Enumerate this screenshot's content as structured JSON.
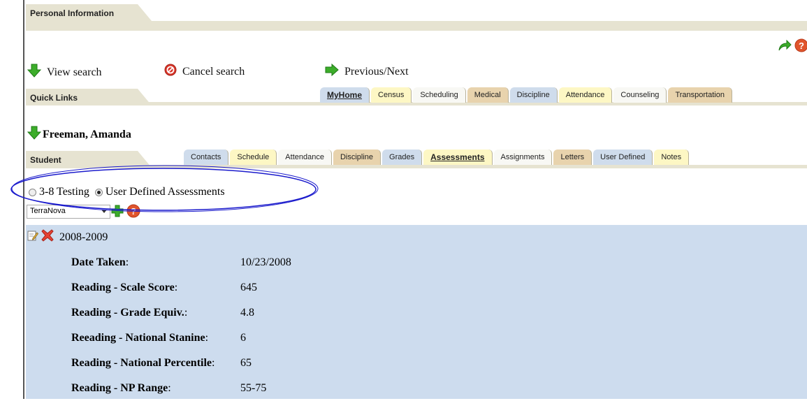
{
  "personal_info": {
    "title": "Personal Information"
  },
  "top_icons": {
    "forward": "forward-arrow-icon",
    "help": "help-icon"
  },
  "search_bar": {
    "view_search": "View search",
    "cancel_search": "Cancel search",
    "previous_next": "Previous/Next"
  },
  "quick_links": {
    "title": "Quick Links",
    "tabs": [
      {
        "label": "MyHome",
        "color": "#cfdcec",
        "active": true
      },
      {
        "label": "Census",
        "color": "#fdf7c4"
      },
      {
        "label": "Scheduling",
        "color": "#f8f8f4"
      },
      {
        "label": "Medical",
        "color": "#e8d3ad"
      },
      {
        "label": "Discipline",
        "color": "#cfdcec"
      },
      {
        "label": "Attendance",
        "color": "#fdf7c4"
      },
      {
        "label": "Counseling",
        "color": "#f8f8f4"
      },
      {
        "label": "Transportation",
        "color": "#e8d3ad"
      }
    ]
  },
  "student": {
    "name": "Freeman, Amanda",
    "title": "Student",
    "tabs": [
      {
        "label": "Contacts",
        "color": "#cfdcec"
      },
      {
        "label": "Schedule",
        "color": "#fdf7c4"
      },
      {
        "label": "Attendance",
        "color": "#f8f8f4"
      },
      {
        "label": "Discipline",
        "color": "#e8d3ad"
      },
      {
        "label": "Grades",
        "color": "#cfdcec"
      },
      {
        "label": "Assessments",
        "color": "#fdf7c4",
        "active": true
      },
      {
        "label": "Assignments",
        "color": "#f8f8f4"
      },
      {
        "label": "Letters",
        "color": "#e8d3ad"
      },
      {
        "label": "User Defined",
        "color": "#cfdcec"
      },
      {
        "label": "Notes",
        "color": "#fdf7c4"
      }
    ]
  },
  "assessment_type": {
    "option1": "3-8 Testing",
    "option2": "User Defined Assessments",
    "selected": "User Defined Assessments"
  },
  "assessment_select": {
    "value": "TerraNova"
  },
  "record": {
    "year": "2008-2009",
    "fields": [
      {
        "label": "Date Taken",
        "value": "10/23/2008"
      },
      {
        "label": "Reading - Scale Score",
        "value": "645"
      },
      {
        "label": "Reading - Grade Equiv.",
        "value": "4.8"
      },
      {
        "label": "Reeading - National Stanine",
        "value": "6"
      },
      {
        "label": "Reading - National Percentile",
        "value": "65"
      },
      {
        "label": "Reading - NP Range",
        "value": "55-75"
      }
    ]
  },
  "colors": {
    "panel": "#cddcee",
    "section": "#e6e3d1",
    "green_icon": "#3cad2a",
    "cancel_icon": "#d9362b",
    "ellipse": "#1a1acc"
  }
}
